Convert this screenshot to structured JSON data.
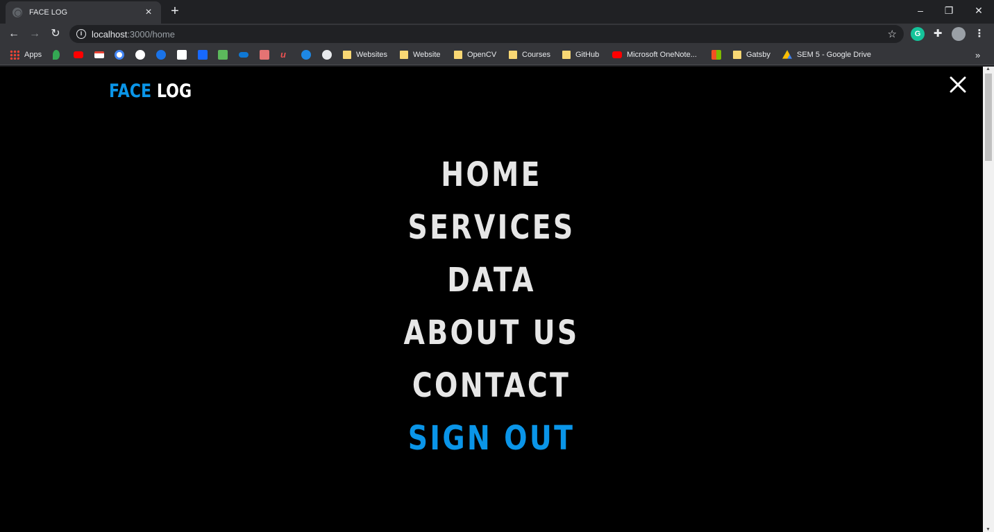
{
  "browser": {
    "tab_title": "FACE LOG",
    "url_host": "localhost",
    "url_path": ":3000/home",
    "bookmarks": [
      {
        "label": "Apps",
        "icon": "apps-grid-icon"
      },
      {
        "label": "",
        "icon": "google-maps-icon"
      },
      {
        "label": "",
        "icon": "youtube-icon"
      },
      {
        "label": "",
        "icon": "gmail-icon"
      },
      {
        "label": "",
        "icon": "google-icon"
      },
      {
        "label": "",
        "icon": "github-icon"
      },
      {
        "label": "",
        "icon": "reddit-icon"
      },
      {
        "label": "",
        "icon": "pocket-icon"
      },
      {
        "label": "",
        "icon": "behance-icon"
      },
      {
        "label": "",
        "icon": "green-app-icon"
      },
      {
        "label": "",
        "icon": "onedrive-icon"
      },
      {
        "label": "",
        "icon": "box-icon"
      },
      {
        "label": "",
        "icon": "udemy-icon"
      },
      {
        "label": "",
        "icon": "play-icon"
      },
      {
        "label": "",
        "icon": "globe-icon"
      },
      {
        "label": "Websites",
        "icon": "folder-icon"
      },
      {
        "label": "Website",
        "icon": "folder-icon"
      },
      {
        "label": "OpenCV",
        "icon": "folder-icon"
      },
      {
        "label": "Courses",
        "icon": "folder-icon"
      },
      {
        "label": "GitHub",
        "icon": "folder-icon"
      },
      {
        "label": "Microsoft OneNote...",
        "icon": "youtube-icon"
      },
      {
        "label": "",
        "icon": "microsoft-icon"
      },
      {
        "label": "Gatsby",
        "icon": "folder-icon"
      },
      {
        "label": "SEM 5 - Google Drive",
        "icon": "google-drive-icon"
      }
    ],
    "more_bookmarks": "»"
  },
  "site": {
    "logo_part1": "FACE",
    "logo_part2": "LOG",
    "menu": [
      {
        "label": "HOME"
      },
      {
        "label": "SERVICES"
      },
      {
        "label": "DATA"
      },
      {
        "label": "ABOUT US"
      },
      {
        "label": "CONTACT"
      },
      {
        "label": "SIGN OUT"
      }
    ],
    "colors": {
      "accent": "#0a95e8",
      "text": "#e6e6e6",
      "background": "#000000"
    }
  }
}
